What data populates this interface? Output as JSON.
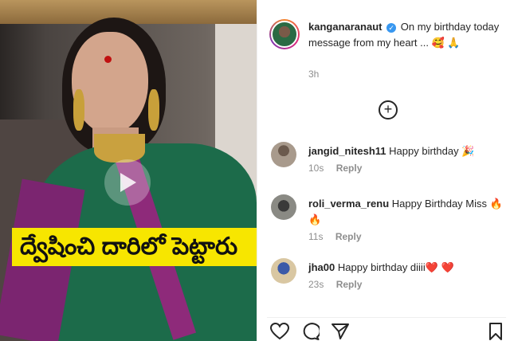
{
  "media": {
    "caption": "ద్వేషించి దారిలో పెట్టారు",
    "play_icon": "play-icon"
  },
  "post": {
    "username": "kanganaranaut",
    "verified_icon": "verified-badge-icon",
    "text": "On my birthday today message from my heart ... 🥰 🙏",
    "time": "3h"
  },
  "add_comment_icon": "plus-circle-icon",
  "comments": [
    {
      "username": "jangid_nitesh11",
      "text": "Happy birthday 🎉",
      "time": "10s",
      "reply": "Reply"
    },
    {
      "username": "roli_verma_renu",
      "text": "Happy Birthday Miss 🔥 🔥",
      "time": "11s",
      "reply": "Reply"
    },
    {
      "username": "jha00",
      "text": "Happy birthday diiii❤️ ❤️",
      "time": "23s",
      "reply": "Reply"
    }
  ],
  "actions": [
    "heart-icon",
    "comment-icon",
    "share-icon",
    "bookmark-icon"
  ],
  "colors": {
    "caption_bg": "#f7e600",
    "verified": "#3897f0",
    "muted": "#8e8e8e"
  }
}
